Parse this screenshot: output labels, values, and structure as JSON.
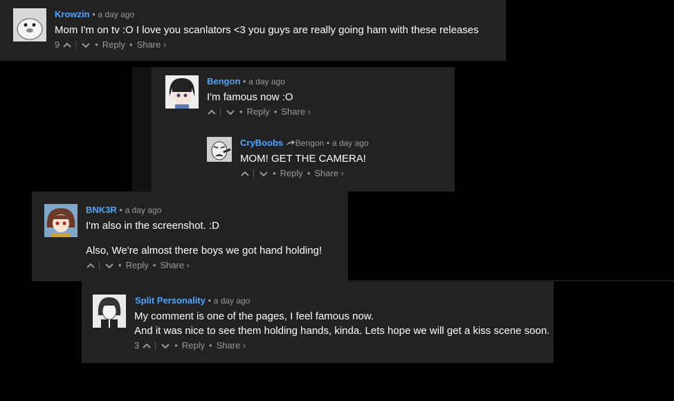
{
  "comments": [
    {
      "author": "Krowzin",
      "time": "a day ago",
      "lines": [
        "Mom I'm on tv :O I love you scanlators <3 you guys are really going ham with these releases"
      ],
      "votes": "9",
      "reply_label": "Reply",
      "share_label": "Share ›"
    },
    {
      "author": "Bengon",
      "time": "a day ago",
      "lines": [
        "I'm famous now :O"
      ],
      "votes": "",
      "reply_label": "Reply",
      "share_label": "Share ›"
    },
    {
      "author": "CryBoobs",
      "reply_to": "Bengon",
      "time": "a day ago",
      "lines": [
        "MOM! GET THE CAMERA!"
      ],
      "votes": "",
      "reply_label": "Reply",
      "share_label": "Share ›"
    },
    {
      "author": "BNK3R",
      "time": "a day ago",
      "lines": [
        "I'm also in the screenshot. :D",
        "Also, We're almost there boys we got hand holding!"
      ],
      "votes": "",
      "reply_label": "Reply",
      "share_label": "Share ›"
    },
    {
      "author": "Split Personality",
      "time": "a day ago",
      "lines": [
        "My comment is one of the pages, I feel famous now.",
        "And it was nice to see them holding hands, kinda. Lets hope we will get a kiss scene soon."
      ],
      "votes": "3",
      "reply_label": "Reply",
      "share_label": "Share ›"
    }
  ],
  "separator": "•",
  "colors": {
    "author": "#4da6ff",
    "panel": "#222222",
    "meta": "#9a9a9a"
  }
}
